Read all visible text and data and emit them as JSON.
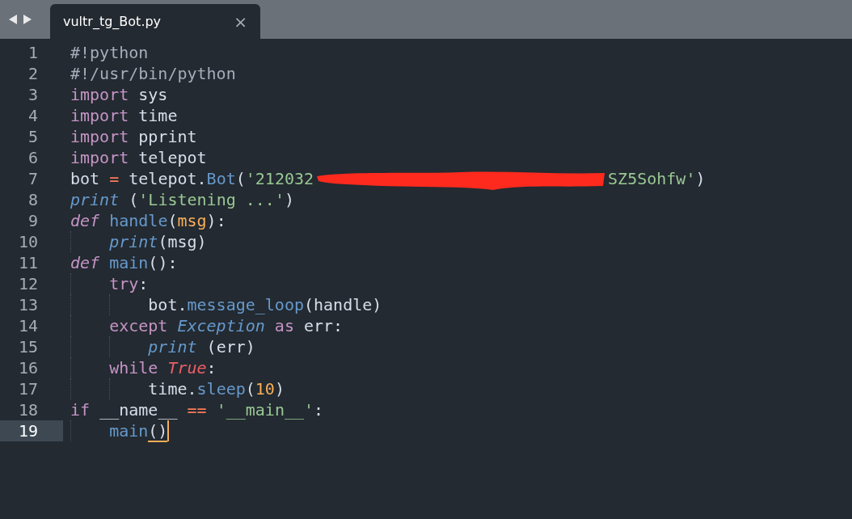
{
  "tabs": [
    {
      "title": "vultr_tg_Bot.py",
      "close": "×",
      "selected": true
    }
  ],
  "lines": [
    {
      "number": "1",
      "current": false,
      "tokens": [
        {
          "kind": "comment",
          "text": "#!python"
        }
      ]
    },
    {
      "number": "2",
      "current": false,
      "tokens": [
        {
          "kind": "comment",
          "text": "#!/usr/bin/python"
        }
      ]
    },
    {
      "number": "3",
      "current": false,
      "tokens": [
        {
          "kind": "keyword",
          "text": "import"
        },
        {
          "kind": "plain",
          "text": " sys"
        }
      ]
    },
    {
      "number": "4",
      "current": false,
      "tokens": [
        {
          "kind": "keyword",
          "text": "import"
        },
        {
          "kind": "plain",
          "text": " time"
        }
      ]
    },
    {
      "number": "5",
      "current": false,
      "tokens": [
        {
          "kind": "keyword",
          "text": "import"
        },
        {
          "kind": "plain",
          "text": " pprint"
        }
      ]
    },
    {
      "number": "6",
      "current": false,
      "tokens": [
        {
          "kind": "keyword",
          "text": "import"
        },
        {
          "kind": "plain",
          "text": " telepot"
        }
      ]
    },
    {
      "number": "7",
      "current": false,
      "tokens": [
        {
          "kind": "plain",
          "text": "bot "
        },
        {
          "kind": "operator",
          "text": "="
        },
        {
          "kind": "plain",
          "text": " telepot."
        },
        {
          "kind": "function",
          "text": "Bot"
        },
        {
          "kind": "plain",
          "text": "("
        },
        {
          "kind": "string",
          "text": "'212032"
        },
        {
          "kind": "redaction"
        },
        {
          "kind": "string",
          "text": "SZ5Sohfw'"
        },
        {
          "kind": "plain",
          "text": ")"
        }
      ]
    },
    {
      "number": "8",
      "current": false,
      "tokens": [
        {
          "kind": "builtin",
          "text": "print"
        },
        {
          "kind": "plain",
          "text": " ("
        },
        {
          "kind": "string",
          "text": "'Listening ...'"
        },
        {
          "kind": "plain",
          "text": ")"
        }
      ]
    },
    {
      "number": "9",
      "current": false,
      "tokens": [
        {
          "kind": "storage",
          "text": "def "
        },
        {
          "kind": "function",
          "text": "handle"
        },
        {
          "kind": "plain",
          "text": "("
        },
        {
          "kind": "parameter",
          "text": "msg"
        },
        {
          "kind": "plain",
          "text": "):"
        }
      ],
      "children": [
        {
          "number": "10",
          "current": false,
          "tokens": [
            {
              "kind": "builtin",
              "text": "print"
            },
            {
              "kind": "plain",
              "text": "(msg)"
            }
          ]
        }
      ]
    },
    {
      "number": "11",
      "current": false,
      "tokens": [
        {
          "kind": "storage",
          "text": "def "
        },
        {
          "kind": "function",
          "text": "main"
        },
        {
          "kind": "plain",
          "text": "():"
        }
      ],
      "children": [
        {
          "number": "12",
          "current": false,
          "tokens": [
            {
              "kind": "keyword",
              "text": "try"
            },
            {
              "kind": "plain",
              "text": ":"
            }
          ],
          "children": [
            {
              "number": "13",
              "current": false,
              "tokens": [
                {
                  "kind": "plain",
                  "text": "bot."
                },
                {
                  "kind": "function",
                  "text": "message_loop"
                },
                {
                  "kind": "plain",
                  "text": "(handle)"
                }
              ]
            }
          ]
        },
        {
          "number": "14",
          "current": false,
          "tokens": [
            {
              "kind": "keyword",
              "text": "except "
            },
            {
              "kind": "builtin",
              "text": "Exception"
            },
            {
              "kind": "keyword",
              "text": " as"
            },
            {
              "kind": "plain",
              "text": " err:"
            }
          ],
          "children": [
            {
              "number": "15",
              "current": false,
              "tokens": [
                {
                  "kind": "builtin",
                  "text": "print"
                },
                {
                  "kind": "plain",
                  "text": " (err)"
                }
              ]
            }
          ]
        },
        {
          "number": "16",
          "current": false,
          "tokens": [
            {
              "kind": "keyword",
              "text": "while "
            },
            {
              "kind": "constant",
              "text": "True"
            },
            {
              "kind": "plain",
              "text": ":"
            }
          ],
          "children": [
            {
              "number": "17",
              "current": false,
              "tokens": [
                {
                  "kind": "plain",
                  "text": "time."
                },
                {
                  "kind": "function",
                  "text": "sleep"
                },
                {
                  "kind": "plain",
                  "text": "("
                },
                {
                  "kind": "number",
                  "text": "10"
                },
                {
                  "kind": "plain",
                  "text": ")"
                }
              ]
            }
          ]
        }
      ]
    },
    {
      "number": "18",
      "current": false,
      "tokens": [
        {
          "kind": "keyword",
          "text": "if"
        },
        {
          "kind": "plain",
          "text": " __name__ "
        },
        {
          "kind": "operator",
          "text": "== "
        },
        {
          "kind": "string",
          "text": "'__main__'"
        },
        {
          "kind": "plain",
          "text": ":"
        }
      ],
      "children": [
        {
          "number": "19",
          "current": true,
          "tokens": [
            {
              "kind": "function",
              "text": "main"
            },
            {
              "kind": "bracket",
              "text": "()"
            }
          ]
        }
      ]
    }
  ]
}
